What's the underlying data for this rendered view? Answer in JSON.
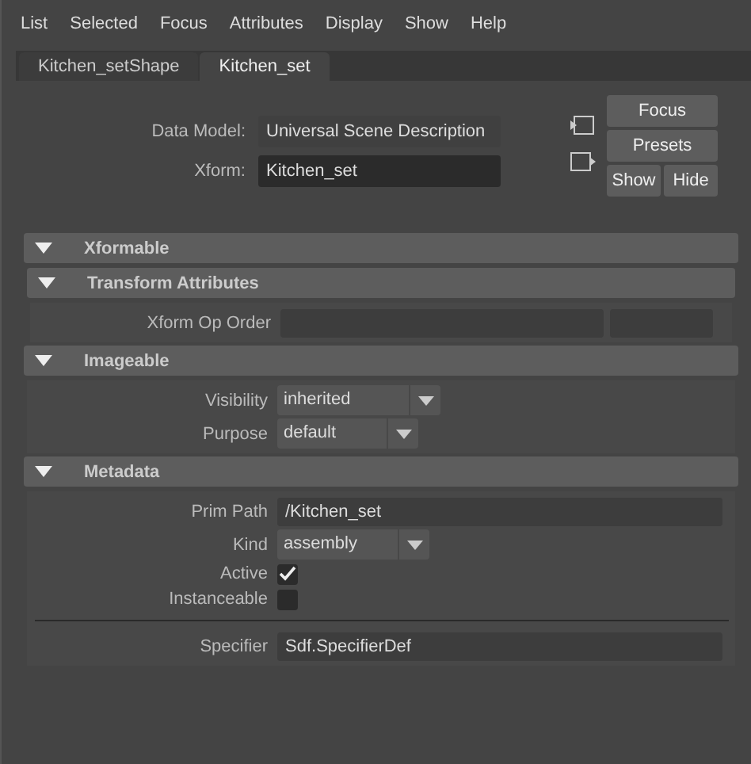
{
  "menu": [
    "List",
    "Selected",
    "Focus",
    "Attributes",
    "Display",
    "Show",
    "Help"
  ],
  "tabs": [
    {
      "label": "Kitchen_setShape",
      "selected": false
    },
    {
      "label": "Kitchen_set",
      "selected": true
    }
  ],
  "header": {
    "fields": [
      {
        "label": "Data Model:",
        "value": "Universal Scene Description",
        "editable": false
      },
      {
        "label": "Xform:",
        "value": "Kitchen_set",
        "editable": true
      }
    ],
    "buttons": [
      "Focus",
      "Presets"
    ],
    "pair_buttons": [
      "Show",
      "Hide"
    ]
  },
  "sections": [
    {
      "title": "Xformable",
      "expanded": true,
      "children": [
        {
          "title": "Transform Attributes",
          "expanded": true,
          "rows": [
            {
              "kind": "double",
              "label": "Xform Op Order"
            }
          ]
        }
      ]
    },
    {
      "title": "Imageable",
      "expanded": true,
      "rows": [
        {
          "kind": "dropdown",
          "label": "Visibility",
          "value": "inherited"
        },
        {
          "kind": "dropdown",
          "label": "Purpose",
          "value": "default"
        }
      ]
    },
    {
      "title": "Metadata",
      "expanded": true,
      "rows": [
        {
          "kind": "field",
          "label": "Prim Path",
          "value": "/Kitchen_set"
        },
        {
          "kind": "dropdown",
          "label": "Kind",
          "value": "assembly"
        },
        {
          "kind": "checkbox",
          "label": "Active",
          "checked": true
        },
        {
          "kind": "checkbox",
          "label": "Instanceable",
          "checked": false
        },
        {
          "kind": "separator"
        },
        {
          "kind": "field",
          "label": "Specifier",
          "value": "Sdf.SpecifierDef"
        }
      ]
    }
  ]
}
